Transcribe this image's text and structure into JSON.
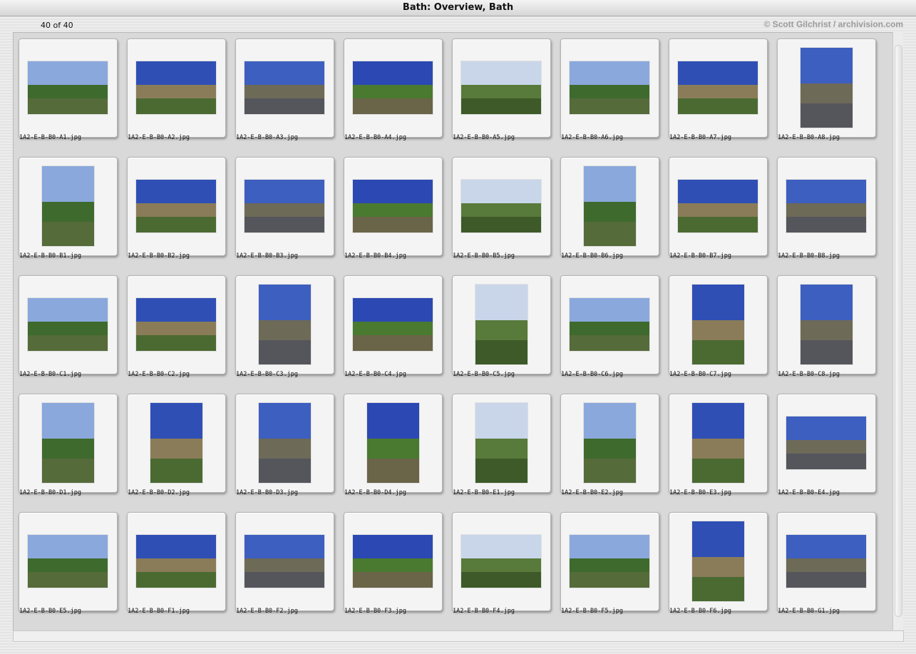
{
  "window": {
    "title": "Bath: Overview, Bath"
  },
  "header": {
    "count": "40 of 40",
    "credit": "© Scott Gilchrist / archivision.com"
  },
  "colors": {
    "sky_blue": "#2c49b0",
    "sky_pale": "#c9d6ea",
    "stone": "#9a8a60",
    "green": "#3d6a2a",
    "road": "#55586a"
  },
  "thumbnails": [
    {
      "filename": "1A2-E-B-B0-A1.jpg",
      "orientation": "landscape"
    },
    {
      "filename": "1A2-E-B-B0-A2.jpg",
      "orientation": "landscape"
    },
    {
      "filename": "1A2-E-B-B0-A3.jpg",
      "orientation": "landscape"
    },
    {
      "filename": "1A2-E-B-B0-A4.jpg",
      "orientation": "landscape"
    },
    {
      "filename": "1A2-E-B-B0-A5.jpg",
      "orientation": "landscape"
    },
    {
      "filename": "1A2-E-B-B0-A6.jpg",
      "orientation": "landscape"
    },
    {
      "filename": "1A2-E-B-B0-A7.jpg",
      "orientation": "landscape"
    },
    {
      "filename": "1A2-E-B-B0-A8.jpg",
      "orientation": "portrait"
    },
    {
      "filename": "1A2-E-B-B0-B1.jpg",
      "orientation": "portrait"
    },
    {
      "filename": "1A2-E-B-B0-B2.jpg",
      "orientation": "landscape"
    },
    {
      "filename": "1A2-E-B-B0-B3.jpg",
      "orientation": "landscape"
    },
    {
      "filename": "1A2-E-B-B0-B4.jpg",
      "orientation": "landscape"
    },
    {
      "filename": "1A2-E-B-B0-B5.jpg",
      "orientation": "landscape"
    },
    {
      "filename": "1A2-E-B-B0-B6.jpg",
      "orientation": "portrait"
    },
    {
      "filename": "1A2-E-B-B0-B7.jpg",
      "orientation": "landscape"
    },
    {
      "filename": "1A2-E-B-B0-B8.jpg",
      "orientation": "landscape"
    },
    {
      "filename": "1A2-E-B-B0-C1.jpg",
      "orientation": "landscape"
    },
    {
      "filename": "1A2-E-B-B0-C2.jpg",
      "orientation": "landscape"
    },
    {
      "filename": "1A2-E-B-B0-C3.jpg",
      "orientation": "portrait"
    },
    {
      "filename": "1A2-E-B-B0-C4.jpg",
      "orientation": "landscape"
    },
    {
      "filename": "1A2-E-B-B0-C5.jpg",
      "orientation": "portrait"
    },
    {
      "filename": "1A2-E-B-B0-C6.jpg",
      "orientation": "landscape"
    },
    {
      "filename": "1A2-E-B-B0-C7.jpg",
      "orientation": "portrait"
    },
    {
      "filename": "1A2-E-B-B0-C8.jpg",
      "orientation": "portrait"
    },
    {
      "filename": "1A2-E-B-B0-D1.jpg",
      "orientation": "portrait"
    },
    {
      "filename": "1A2-E-B-B0-D2.jpg",
      "orientation": "portrait"
    },
    {
      "filename": "1A2-E-B-B0-D3.jpg",
      "orientation": "portrait"
    },
    {
      "filename": "1A2-E-B-B0-D4.jpg",
      "orientation": "portrait"
    },
    {
      "filename": "1A2-E-B-B0-E1.jpg",
      "orientation": "portrait"
    },
    {
      "filename": "1A2-E-B-B0-E2.jpg",
      "orientation": "portrait"
    },
    {
      "filename": "1A2-E-B-B0-E3.jpg",
      "orientation": "portrait"
    },
    {
      "filename": "1A2-E-B-B0-E4.jpg",
      "orientation": "landscape"
    },
    {
      "filename": "1A2-E-B-B0-E5.jpg",
      "orientation": "landscape"
    },
    {
      "filename": "1A2-E-B-B0-F1.jpg",
      "orientation": "landscape"
    },
    {
      "filename": "1A2-E-B-B0-F2.jpg",
      "orientation": "landscape"
    },
    {
      "filename": "1A2-E-B-B0-F3.jpg",
      "orientation": "landscape"
    },
    {
      "filename": "1A2-E-B-B0-F4.jpg",
      "orientation": "landscape"
    },
    {
      "filename": "1A2-E-B-B0-F5.jpg",
      "orientation": "landscape"
    },
    {
      "filename": "1A2-E-B-B0-F6.jpg",
      "orientation": "portrait"
    },
    {
      "filename": "1A2-E-B-B0-G1.jpg",
      "orientation": "landscape"
    }
  ]
}
